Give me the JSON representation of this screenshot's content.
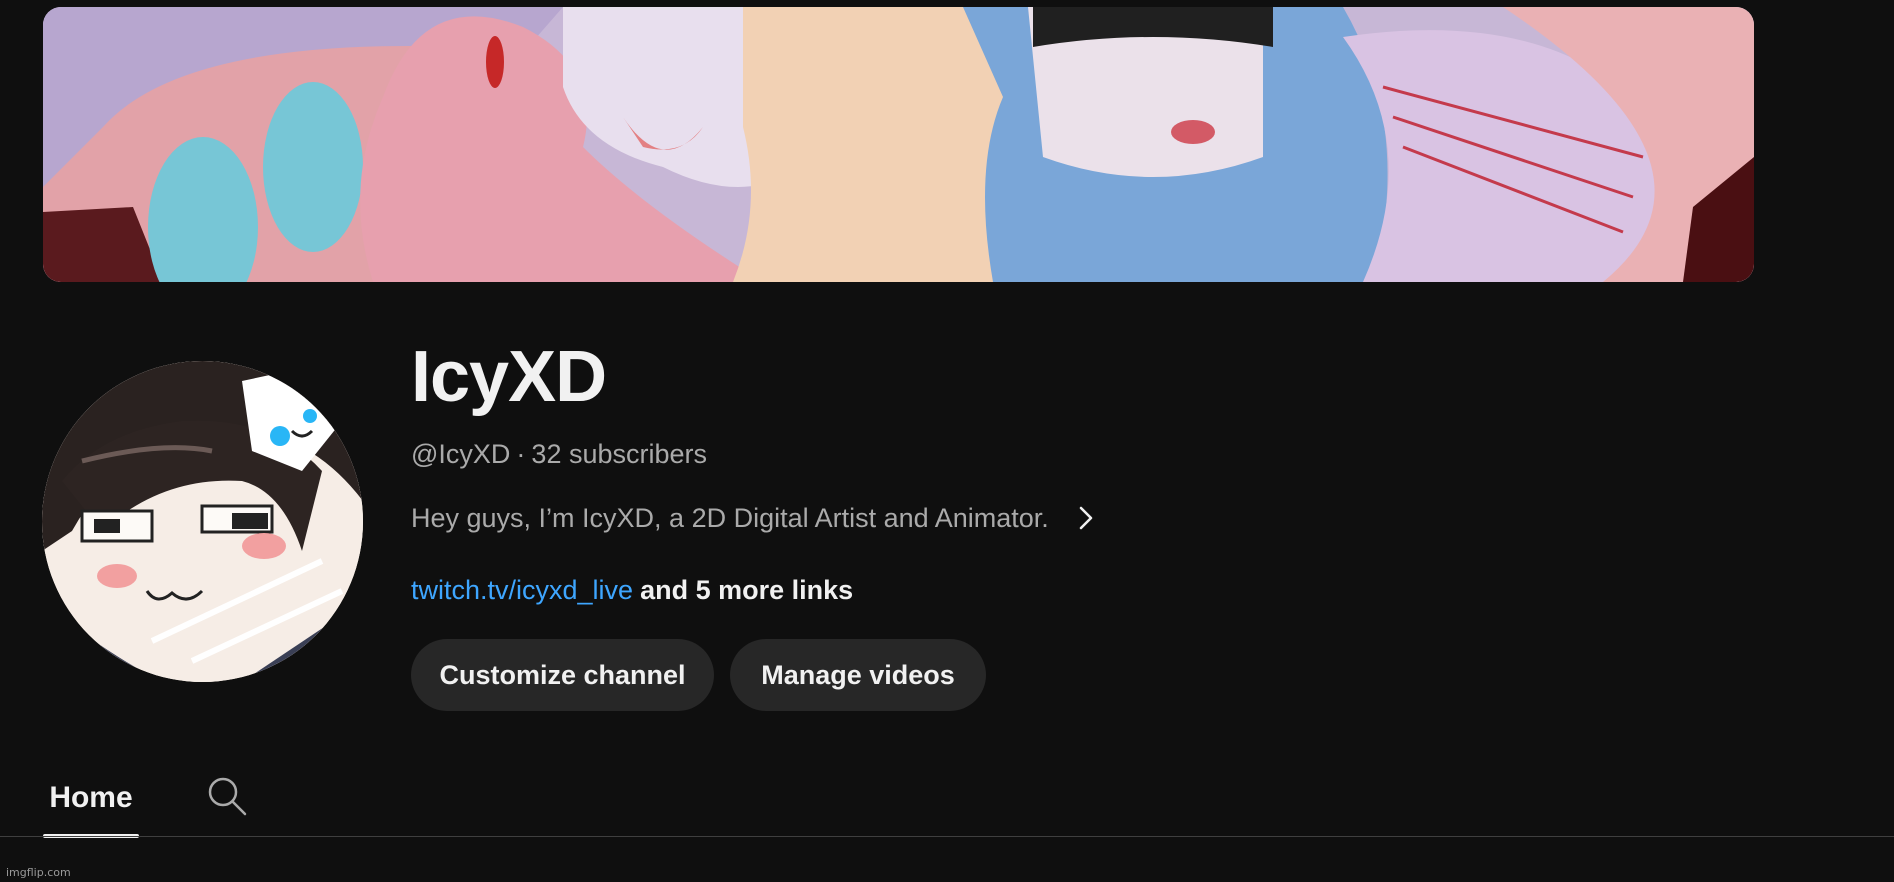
{
  "channel": {
    "name": "IcyXD",
    "handle": "@IcyXD",
    "separator": "·",
    "subscribers": "32 subscribers",
    "description": "Hey guys, I’m IcyXD, a 2D Digital Artist and Animator.",
    "link_primary": "twitch.tv/icyxd_live",
    "link_more": "and 5 more links"
  },
  "buttons": {
    "customize": "Customize channel",
    "manage": "Manage videos"
  },
  "tabs": {
    "home": "Home",
    "search_icon": "search-icon"
  },
  "watermark": "imgflip.com",
  "colors": {
    "background": "#0f0f0f",
    "text_primary": "#f1f1f1",
    "text_secondary": "#aaaaaa",
    "link": "#3ea6ff",
    "button_bg": "#272727"
  }
}
